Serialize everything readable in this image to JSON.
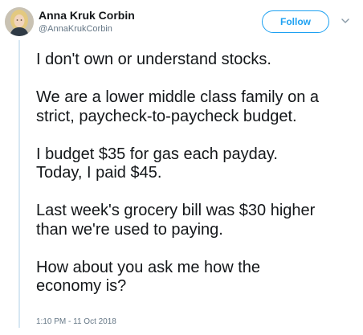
{
  "user": {
    "display_name": "Anna Kruk Corbin",
    "handle": "@AnnaKrukCorbin",
    "avatar_icon": "profile-photo"
  },
  "actions": {
    "follow_label": "Follow",
    "menu_icon": "chevron-down-icon"
  },
  "tweet": {
    "paragraphs": [
      "I don't own or understand stocks.",
      "We are a lower middle class family on a\nstrict, paycheck-to-paycheck budget.",
      "I budget $35 for gas each payday.\nToday, I paid $45.",
      "Last week's grocery bill was $30 higher\nthan we're used to paying.",
      "How about you ask me how the\neconomy is?"
    ],
    "timestamp": "1:10 PM - 11 Oct 2018"
  },
  "colors": {
    "accent": "#1da1f2",
    "text": "#14171a",
    "secondary_text": "#657786",
    "rule": "#d6e7f3"
  }
}
